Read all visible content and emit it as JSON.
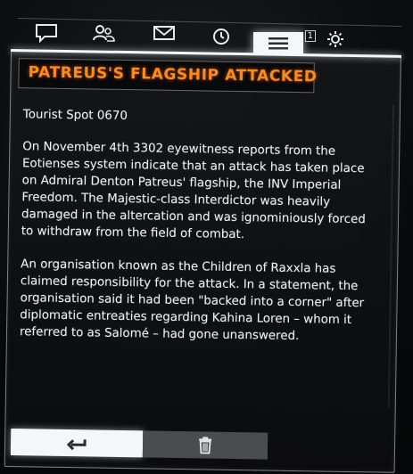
{
  "tabs": [
    {
      "id": "comms",
      "icon": "chat-bubble-icon"
    },
    {
      "id": "contacts",
      "icon": "people-icon"
    },
    {
      "id": "inbox",
      "icon": "envelope-icon"
    },
    {
      "id": "history",
      "icon": "clock-icon"
    },
    {
      "id": "galnet",
      "icon": "list-icon",
      "active": true,
      "badge": "1"
    },
    {
      "id": "options",
      "icon": "gear-icon"
    }
  ],
  "article": {
    "title": "PATREUS'S FLAGSHIP ATTACKED",
    "location": "Tourist Spot 0670",
    "paragraphs": [
      "On November 4th 3302 eyewitness reports from the Eotienses system indicate that an attack has taken place on Admiral Denton Patreus' flagship, the INV Imperial Freedom. The Majestic-class Interdictor was heavily damaged in the altercation and was ignominiously forced to withdraw from the field of combat.",
      "An organisation known as the Children of Raxxla has claimed responsibility for the attack. In a statement, the organisation said it had been \"backed into a corner\" after diplomatic entreaties regarding Kahina Loren – whom it referred to as Salomé – had gone unanswered."
    ]
  },
  "actions": {
    "back_icon": "back-arrow-icon",
    "delete_icon": "trash-icon"
  },
  "colors": {
    "title": "#ff8a1a",
    "text": "#eef1f4",
    "active_tab": "#f4f6f8",
    "inactive_button": "#4a4d50"
  }
}
